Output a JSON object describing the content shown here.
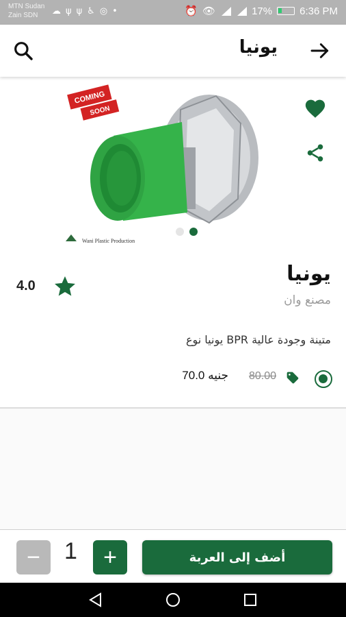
{
  "status_bar": {
    "carrier_line1": "MTN Sudan",
    "carrier_line2": "Zain SDN",
    "battery": "17%",
    "time": "6:36 PM"
  },
  "header": {
    "title": "يونيا",
    "icons": [
      "back-arrow-icon",
      "search-icon"
    ]
  },
  "product": {
    "image_badge": "COMING SOON",
    "image_caption": "Wani Plastic Production",
    "name": "يونيا",
    "factory": "مصنع وان",
    "rating": "4.0",
    "description": "يونيا نوع BPR متينة وجودة عالية",
    "old_price": "80.00",
    "new_price": "70.0 جنيه",
    "carousel_total": 2,
    "carousel_active": 2
  },
  "actions": {
    "add_to_cart_label": "أضف إلى العربة",
    "quantity": "1",
    "plus_label": "+",
    "minus_label": "−"
  },
  "colors": {
    "primary": "#1a6b3c",
    "disabled": "#b9b9b9"
  }
}
